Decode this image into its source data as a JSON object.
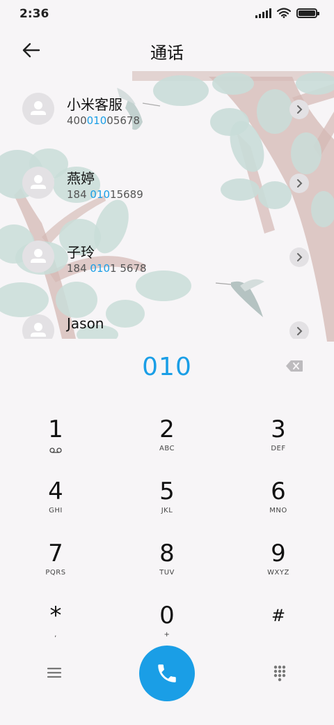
{
  "status": {
    "time": "2:36"
  },
  "header": {
    "title": "通话"
  },
  "contacts": [
    {
      "name": "小米客服",
      "num_a": "400",
      "num_hl": "010",
      "num_b": "05678"
    },
    {
      "name": "燕婷",
      "num_a": "184 ",
      "num_hl": "010",
      "num_b": "15689"
    },
    {
      "name": "子玲",
      "num_a": "184 ",
      "num_hl": "010",
      "num_b": "1 5678"
    },
    {
      "name": "Jason",
      "num_a": "",
      "num_hl": "",
      "num_b": ""
    }
  ],
  "dialpad": {
    "number": "010",
    "keys": [
      {
        "digit": "1",
        "letters": ""
      },
      {
        "digit": "2",
        "letters": "ABC"
      },
      {
        "digit": "3",
        "letters": "DEF"
      },
      {
        "digit": "4",
        "letters": "GHI"
      },
      {
        "digit": "5",
        "letters": "JKL"
      },
      {
        "digit": "6",
        "letters": "MNO"
      },
      {
        "digit": "7",
        "letters": "PQRS"
      },
      {
        "digit": "8",
        "letters": "TUV"
      },
      {
        "digit": "9",
        "letters": "WXYZ"
      },
      {
        "digit": "*",
        "letters": ","
      },
      {
        "digit": "0",
        "letters": "+"
      },
      {
        "digit": "#",
        "letters": ""
      }
    ]
  },
  "colors": {
    "accent": "#1a9ee6",
    "background": "#f7f5f7",
    "leaf": "#c9ddd8",
    "branch": "#d4b8b4"
  },
  "icons": {
    "back": "arrow-left-icon",
    "voicemail": "voicemail-icon",
    "backspace": "backspace-icon",
    "call": "phone-icon",
    "menu": "menu-icon",
    "dialpad": "dialpad-grid-icon"
  }
}
